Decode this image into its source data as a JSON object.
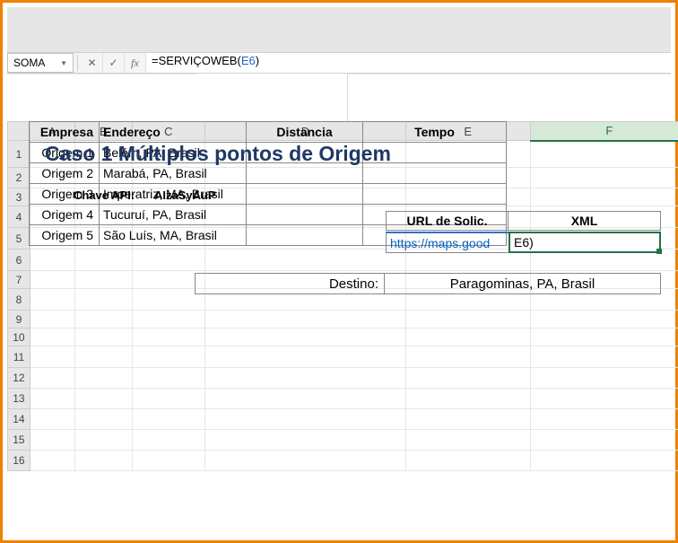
{
  "formula_bar": {
    "name_box": "SOMA",
    "formula_prefix": "=SERVIÇOWEB(",
    "formula_ref": "E6",
    "formula_suffix": ")"
  },
  "columns": [
    "A",
    "B",
    "C",
    "D",
    "E",
    "F"
  ],
  "rows": [
    "1",
    "2",
    "3",
    "4",
    "5",
    "6",
    "7",
    "8",
    "9",
    "10",
    "11",
    "12",
    "13",
    "14",
    "15",
    "16"
  ],
  "selected_col": "F",
  "title": "Caso 1 Múltiplos pontos de Origem",
  "api_key_label": "Chave API:",
  "api_key_value": "AIzaSyAuP",
  "url_header": "URL de Solic.",
  "xml_header": "XML",
  "url_value": "https://maps.good",
  "xml_value": "E6)",
  "dest_label": "Destino:",
  "dest_value": "Paragominas, PA, Brasil",
  "table_headers": {
    "empresa": "Empresa",
    "endereco": "Endereço",
    "distancia": "Distancia",
    "tempo": "Tempo"
  },
  "table_rows": [
    {
      "empresa": "Origem 1",
      "endereco": "Belém, PA, Brasil"
    },
    {
      "empresa": "Origem 2",
      "endereco": "Marabá, PA, Brasil"
    },
    {
      "empresa": "Origem 3",
      "endereco": "Imperatriz, MA, Brasil"
    },
    {
      "empresa": "Origem 4",
      "endereco": "Tucuruí, PA, Brasil"
    },
    {
      "empresa": "Origem 5",
      "endereco": "São Luís, MA, Brasil"
    }
  ]
}
